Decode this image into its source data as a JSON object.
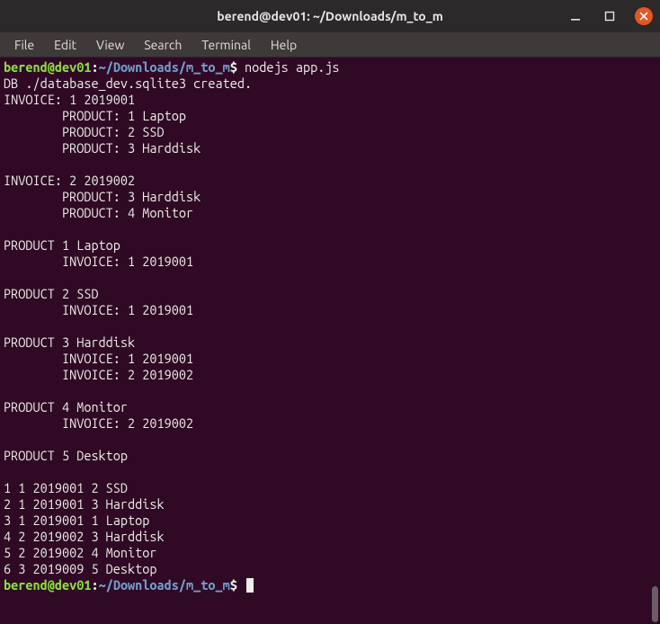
{
  "titlebar": {
    "title": "berend@dev01: ~/Downloads/m_to_m"
  },
  "menubar": {
    "items": [
      "File",
      "Edit",
      "View",
      "Search",
      "Terminal",
      "Help"
    ]
  },
  "prompt": {
    "user_host": "berend@dev01",
    "sep1": ":",
    "path": "~/Downloads/m_to_m",
    "sigil": "$"
  },
  "command": " nodejs app.js",
  "output_lines": [
    "DB ./database_dev.sqlite3 created.",
    "INVOICE: 1 2019001",
    "        PRODUCT: 1 Laptop",
    "        PRODUCT: 2 SSD",
    "        PRODUCT: 3 Harddisk",
    "",
    "INVOICE: 2 2019002",
    "        PRODUCT: 3 Harddisk",
    "        PRODUCT: 4 Monitor",
    "",
    "PRODUCT 1 Laptop",
    "        INVOICE: 1 2019001",
    "",
    "PRODUCT 2 SSD",
    "        INVOICE: 1 2019001",
    "",
    "PRODUCT 3 Harddisk",
    "        INVOICE: 1 2019001",
    "        INVOICE: 2 2019002",
    "",
    "PRODUCT 4 Monitor",
    "        INVOICE: 2 2019002",
    "",
    "PRODUCT 5 Desktop",
    "",
    "1 1 2019001 2 SSD",
    "2 1 2019001 3 Harddisk",
    "3 1 2019001 1 Laptop",
    "4 2 2019002 3 Harddisk",
    "5 2 2019002 4 Monitor",
    "6 3 2019009 5 Desktop"
  ]
}
